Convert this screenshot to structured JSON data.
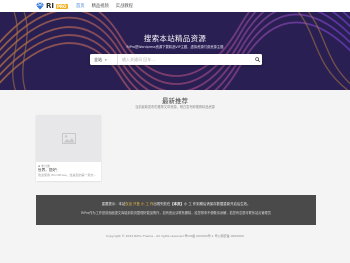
{
  "colors": {
    "brand_blue": "#3b7ddd",
    "hero_bg": "#33266b",
    "hero_wave_orange": "#f09a3e",
    "hero_wave_purple": "#7c4dff",
    "notice_bg": "#4a4a4a",
    "badge": "#f2b01e",
    "highlight": "#f5c243"
  },
  "nav": {
    "logo_icon": "diamond-icon",
    "logo_text": "RI",
    "logo_badge": "PRO",
    "items": [
      {
        "label": "首页",
        "active": true
      },
      {
        "label": "精品视频",
        "active": false
      },
      {
        "label": "实战教程",
        "active": false
      }
    ]
  },
  "hero": {
    "title": "搜索本站精品资源",
    "subtitle": "RiPro是Wordpress资源下载精品VIP主题，虚拟资源付费资源主题",
    "search": {
      "category": "全站",
      "placeholder": "输入关键词 回车...",
      "button_icon": "search-icon"
    }
  },
  "section": {
    "title": "最新推荐",
    "subtitle": "当前最新发布的推荐文章资源，明白发布即推荐精品资源"
  },
  "cards": [
    {
      "thumb_icon": "image-placeholder-icon",
      "category_icon": "folder-icon",
      "category": "未分类",
      "title": "世界，您好！",
      "excerpt": "欢迎使用 WordPress。这是您的第一篇文..."
    }
  ],
  "notice": {
    "line1_pre": "重要提示：本站",
    "line1_hl": "仅出 只售 小 工 作",
    "line1_mid": "出现失败在",
    "line1_strong": "【本页】",
    "line1_post": "小 工 作到期后请保存数据重新开启后生效。",
    "line2": "RiPro作为工作是前面面提文库能到前页整理好能加购作，如有违反请联系删除，给您带来不便敬请谅解，若您有意愿可联系站点管理员"
  },
  "footer": {
    "text": "Copyright © 2023 RiPro Theme - All rights reserved 粤ICP备 000000号-1 粤公网安备 0000000"
  }
}
